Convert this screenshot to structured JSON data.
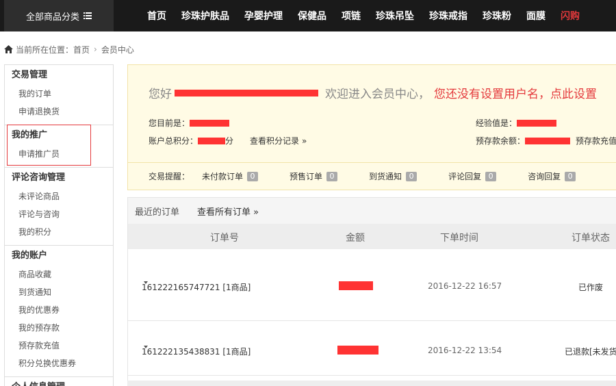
{
  "topbar": {
    "category_label": "全部商品分类",
    "nav": [
      "首页",
      "珍珠护肤品",
      "孕婴护理",
      "保健品",
      "项链",
      "珍珠吊坠",
      "珍珠戒指",
      "珍珠粉",
      "面膜",
      "闪购"
    ]
  },
  "breadcrumb": {
    "prefix": "当前所在位置：",
    "home": "首页",
    "current": "会员中心"
  },
  "sidebar": [
    {
      "title": "交易管理",
      "items": [
        "我的订单",
        "申请退换货"
      ]
    },
    {
      "title": "我的推广",
      "items": [
        "申请推广员"
      ]
    },
    {
      "title": "评论咨询管理",
      "items": [
        "未评论商品",
        "评论与咨询",
        "我的积分"
      ]
    },
    {
      "title": "我的账户",
      "items": [
        "商品收藏",
        "到货通知",
        "我的优惠券",
        "我的预存款",
        "预存款充值",
        "积分兑换优惠券"
      ]
    },
    {
      "title": "个人信息管理",
      "items": []
    }
  ],
  "welcome": {
    "greet_prefix": "您好",
    "greet_suffix": "欢迎进入会员中心，",
    "greet_link": "您还没有设置用户名，点此设置",
    "level_label": "您目前是：",
    "points_label": "账户总积分：",
    "points_suffix": "分",
    "points_link": "查看积分记录",
    "exp_label": "经验值是：",
    "deposit_label": "预存款余额：",
    "deposit_link": "预存款充值"
  },
  "reminders": {
    "label": "交易提醒：",
    "items": [
      {
        "label": "未付款订单",
        "count": "0"
      },
      {
        "label": "预售订单",
        "count": "0"
      },
      {
        "label": "到货通知",
        "count": "0"
      },
      {
        "label": "评论回复",
        "count": "0"
      },
      {
        "label": "咨询回复",
        "count": "0"
      }
    ]
  },
  "orders": {
    "title": "最近的订单",
    "view_all": "查看所有订单",
    "columns": [
      "订单号",
      "金额",
      "下单时间",
      "订单状态"
    ],
    "rows": [
      {
        "id": "161222165747721 [1商品]",
        "time": "2016-12-22 16:57",
        "status": "已作废"
      },
      {
        "id": "161222135438831 [1商品]",
        "time": "2016-12-22 13:54",
        "status": "已退款[未发货"
      }
    ]
  },
  "colors": {
    "accent": "#e4393c",
    "topbar": "#1a1a1a",
    "welcome_bg": "#fffbe5"
  }
}
